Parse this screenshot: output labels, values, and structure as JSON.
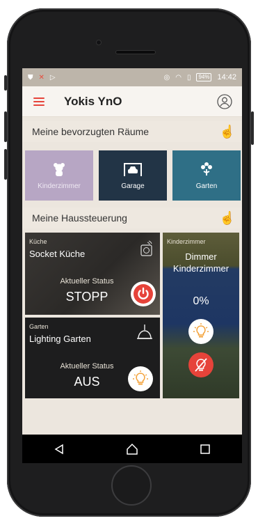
{
  "statusbar": {
    "battery": "94%",
    "time": "14:42"
  },
  "appbar": {
    "title": "Yokis YnO"
  },
  "favorites": {
    "header": "Meine bevorzugten Räume",
    "rooms": [
      {
        "label": "Kinderzimmer",
        "icon": "teddy-bear-icon",
        "color": "#b7a6c4"
      },
      {
        "label": "Garage",
        "icon": "garage-car-icon",
        "color": "#223446"
      },
      {
        "label": "Garten",
        "icon": "flower-icon",
        "color": "#2f6f86"
      }
    ]
  },
  "controls": {
    "header": "Meine Haussteuerung",
    "cards": [
      {
        "room": "Küche",
        "name": "Socket Küche",
        "status_label": "Aktueller Status",
        "status_value": "STOPP",
        "icon": "socket-icon",
        "action_icon": "power-icon",
        "action_color": "#e6433a"
      },
      {
        "room": "Kinderzimmer",
        "name": "Dimmer Kinderzimmer",
        "level": "0%",
        "icon": "bulb-icon",
        "off_icon": "bulb-off-icon",
        "off_color": "#e6433a"
      },
      {
        "room": "Garten",
        "name": "Lighting Garten",
        "status_label": "Aktueller Status",
        "status_value": "AUS",
        "icon": "ceiling-lamp-icon",
        "action_icon": "bulb-icon"
      }
    ]
  },
  "nav": {
    "back": "back-icon",
    "home": "home-icon",
    "recents": "recents-icon"
  }
}
